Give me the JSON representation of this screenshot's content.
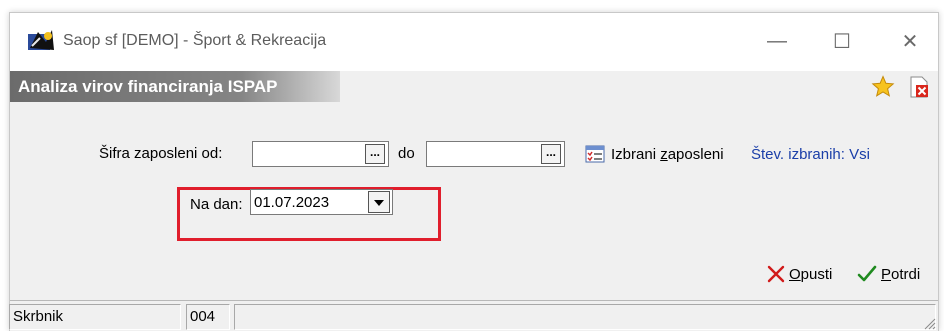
{
  "window": {
    "title": "Saop sf [DEMO] - Šport & Rekreacija",
    "controls": {
      "minimize": "—",
      "maximize": "☐",
      "close": "✕"
    }
  },
  "header": {
    "title": "Analiza virov financiranja ISPAP",
    "favorite_icon": "star-icon",
    "close_doc_icon": "document-close-icon"
  },
  "form": {
    "employee_from_label": "Šifra zaposleni od:",
    "employee_from_value": "",
    "to_label": "do",
    "employee_to_value": "",
    "ellipsis": "...",
    "selected_employees_prefix": "Izbrani ",
    "selected_employees_accel": "z",
    "selected_employees_suffix": "aposleni",
    "selected_count_text": "Štev. izbranih: Vsi",
    "date_label": "Na dan:",
    "date_value": "01.07.2023"
  },
  "actions": {
    "cancel_accel": "O",
    "cancel_rest": "pusti",
    "confirm_accel": "P",
    "confirm_rest": "otrdi"
  },
  "status": {
    "user": "Skrbnik",
    "code": "004",
    "extra": ""
  },
  "colors": {
    "highlight": "#e01e2c",
    "link": "#1a3ea8",
    "header_gradient_start": "#6b6b6b"
  }
}
